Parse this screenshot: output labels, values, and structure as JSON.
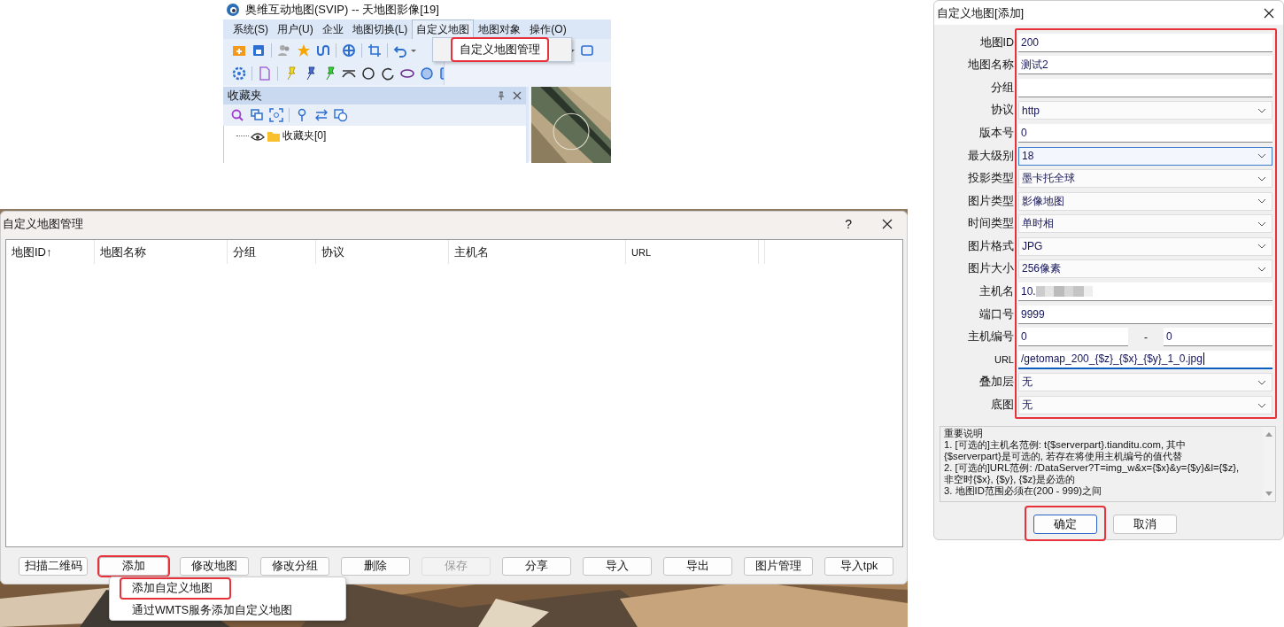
{
  "main_window": {
    "title": "奥维互动地图(SVIP) -- 天地图影像[19]",
    "menu": [
      {
        "label": "系统(S)",
        "selected": false
      },
      {
        "label": "用户(U)",
        "selected": false
      },
      {
        "label": "企业",
        "selected": false
      },
      {
        "label": "地图切换(L)",
        "selected": false
      },
      {
        "label": "自定义地图",
        "selected": true
      },
      {
        "label": "地图对象",
        "selected": false
      },
      {
        "label": "操作(O)",
        "selected": false
      }
    ],
    "open_menu": [
      {
        "label": "自定义地图管理",
        "highlighted": true
      }
    ],
    "favorites": {
      "title": "收藏夹",
      "tree": [
        {
          "label": "收藏夹[0]"
        }
      ]
    }
  },
  "manage_dialog": {
    "title": "自定义地图管理",
    "help": "?",
    "columns": [
      {
        "label": "地图ID↑"
      },
      {
        "label": "地图名称"
      },
      {
        "label": "分组"
      },
      {
        "label": "协议"
      },
      {
        "label": "主机名"
      },
      {
        "label": "URL"
      }
    ],
    "buttons": [
      {
        "label": "扫描二维码",
        "disabled": false,
        "highlighted": false
      },
      {
        "label": "添加",
        "disabled": false,
        "highlighted": true
      },
      {
        "label": "修改地图",
        "disabled": false,
        "highlighted": false
      },
      {
        "label": "修改分组",
        "disabled": false,
        "highlighted": false
      },
      {
        "label": "删除",
        "disabled": false,
        "highlighted": false
      },
      {
        "label": "保存",
        "disabled": true,
        "highlighted": false
      },
      {
        "label": "分享",
        "disabled": false,
        "highlighted": false
      },
      {
        "label": "导入",
        "disabled": false,
        "highlighted": false
      },
      {
        "label": "导出",
        "disabled": false,
        "highlighted": false
      },
      {
        "label": "图片管理",
        "disabled": false,
        "highlighted": false
      },
      {
        "label": "导入tpk",
        "disabled": false,
        "highlighted": false
      }
    ],
    "popup_menu": [
      {
        "label": "添加自定义地图",
        "highlighted": true
      },
      {
        "label": "通过WMTS服务添加自定义地图",
        "highlighted": false
      }
    ]
  },
  "add_dialog": {
    "title": "自定义地图[添加]",
    "fields_highlighted": true,
    "fields": [
      {
        "label": "地图ID",
        "kind": "text",
        "value": "200",
        "focused": false
      },
      {
        "label": "地图名称",
        "kind": "text",
        "value": "测试2",
        "focused": false
      },
      {
        "label": "分组",
        "kind": "text",
        "focused": false
      },
      {
        "label": "协议",
        "kind": "select",
        "value": "http",
        "focused": false
      },
      {
        "label": "版本号",
        "kind": "text",
        "value": "0",
        "focused": false
      },
      {
        "label": "最大级别",
        "kind": "select",
        "value": "18",
        "focused": true
      },
      {
        "label": "投影类型",
        "kind": "select",
        "value": "墨卡托全球",
        "focused": false
      },
      {
        "label": "图片类型",
        "kind": "select",
        "value": "影像地图",
        "focused": false
      },
      {
        "label": "时间类型",
        "kind": "select",
        "value": "单时相",
        "focused": false
      },
      {
        "label": "图片格式",
        "kind": "select",
        "value": "JPG",
        "focused": false
      },
      {
        "label": "图片大小",
        "kind": "select",
        "value": "256像素",
        "focused": false
      },
      {
        "label": "主机名",
        "kind": "text",
        "value": "10.",
        "redacted": true,
        "focused": false
      },
      {
        "label": "端口号",
        "kind": "text",
        "value": "9999",
        "focused": false
      },
      {
        "label": "主机编号",
        "kind": "range",
        "value": "0",
        "separator": "-",
        "value_to": "0",
        "focused": false
      },
      {
        "label": "URL",
        "kind": "text",
        "value": "/getomap_200_{$z}_{$x}_{$y}_1_0.jpg",
        "focused": true
      },
      {
        "label": "叠加层",
        "kind": "select",
        "value": "无",
        "focused": false
      },
      {
        "label": "底图",
        "kind": "select",
        "value": "无",
        "focused": false
      }
    ],
    "notes": [
      "重要说明",
      "1. [可选的]主机名范例: t{$serverpart}.tianditu.com, 其中",
      "{$serverpart}是可选的, 若存在将使用主机编号的值代替",
      "2. [可选的]URL范例: /DataServer?T=img_w&x={$x}&y={$y}&l={$z},",
      "非空时{$x}, {$y}, {$z}是必选的",
      "3. 地图ID范围必须在(200 - 999)之间"
    ],
    "buttons": [
      {
        "label": "确定",
        "highlighted": true
      },
      {
        "label": "取消",
        "highlighted": false
      }
    ]
  }
}
